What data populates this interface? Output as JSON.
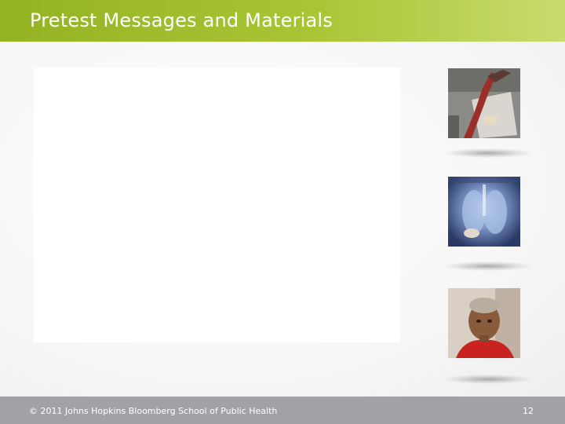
{
  "slide": {
    "title": "Pretest Messages and Materials",
    "footer_text": "© 2011 Johns Hopkins Bloomberg School of Public Health",
    "page_number": "12"
  },
  "thumbnails": [
    {
      "subject": "tobacco-and-organ-photo"
    },
    {
      "subject": "lungs-xray-photo"
    },
    {
      "subject": "woman-portrait-photo"
    }
  ],
  "colors": {
    "header_green": "#a9c534",
    "footer_gray": "#a2a2a6",
    "background": "#f6f6f6"
  }
}
